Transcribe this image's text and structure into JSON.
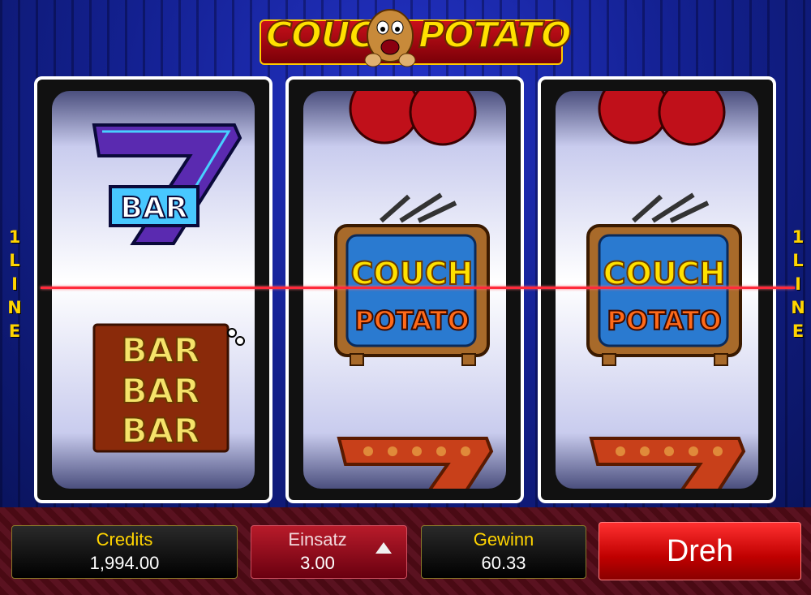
{
  "game": {
    "logo_left": "COUCH",
    "logo_right": "POTATO",
    "line_label_number": "1",
    "line_label_letters": [
      "L",
      "I",
      "N",
      "E"
    ]
  },
  "symbols": {
    "seven_bar_text": "BAR",
    "triple_bar_text": [
      "BAR",
      "BAR",
      "BAR"
    ],
    "tv_line1": "COUCH",
    "tv_line2": "POTATO"
  },
  "reels": [
    [
      "seven-bar",
      "triple-bar"
    ],
    [
      "cherries",
      "couch-potato-tv",
      "seven"
    ],
    [
      "cherries",
      "couch-potato-tv",
      "seven"
    ]
  ],
  "controls": {
    "credits_label": "Credits",
    "credits_value": "1,994.00",
    "bet_label": "Einsatz",
    "bet_value": "3.00",
    "win_label": "Gewinn",
    "win_value": "60.33",
    "spin_label": "Dreh"
  },
  "colors": {
    "payline": "#ff2a3a",
    "accent_gold": "#ffd400",
    "spin_red": "#e00000"
  }
}
